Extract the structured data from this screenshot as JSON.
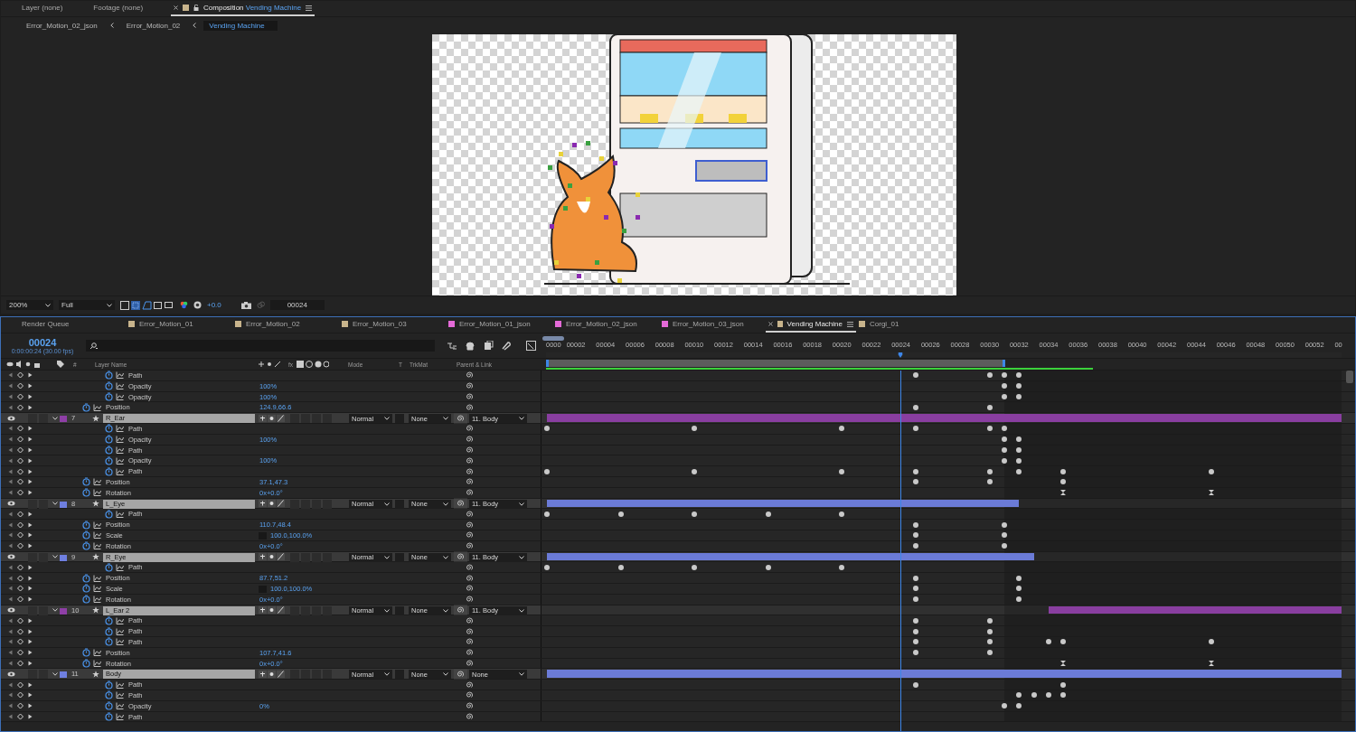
{
  "viewer_tabs": [
    {
      "label": "Layer (none)",
      "kind": "plain",
      "selected": false
    },
    {
      "label": "Footage (none)",
      "kind": "plain",
      "selected": false
    },
    {
      "label": "Composition",
      "name": "Vending Machine",
      "kind": "composition",
      "selected": true,
      "color": "#c8b48c"
    }
  ],
  "breadcrumbs": [
    {
      "label": "Error_Motion_02_json",
      "selected": false
    },
    {
      "label": "Error_Motion_02",
      "selected": false
    },
    {
      "label": "Vending Machine",
      "selected": true
    }
  ],
  "viewer_toolbar": {
    "zoom": "200%",
    "resolution": "Full",
    "exposure": "+0.0",
    "frame": "00024"
  },
  "timeline_tabs": [
    {
      "label": "Render Queue",
      "selected": false
    },
    {
      "label": "Error_Motion_01",
      "selected": false,
      "color": "#c8b48c"
    },
    {
      "label": "Error_Motion_02",
      "selected": false,
      "color": "#c8b48c"
    },
    {
      "label": "Error_Motion_03",
      "selected": false,
      "color": "#c8b48c"
    },
    {
      "label": "Error_Motion_01_json",
      "selected": false,
      "color": "#e46ad8"
    },
    {
      "label": "Error_Motion_02_json",
      "selected": false,
      "color": "#e46ad8"
    },
    {
      "label": "Error_Motion_03_json",
      "selected": false,
      "color": "#e46ad8"
    },
    {
      "label": "Vending Machine",
      "selected": true,
      "color": "#c8b48c"
    },
    {
      "label": "Corgi_01",
      "selected": false,
      "color": "#c8b48c"
    }
  ],
  "timecode": {
    "frame": "00024",
    "time": "0:00:00:24 (30.00 fps)"
  },
  "columns": {
    "number": "#",
    "layer_name": "Layer Name",
    "fx": "fx",
    "mode": "Mode",
    "t": "T",
    "trkmat": "TrkMat",
    "parent": "Parent & Link"
  },
  "ruler": [
    "0000",
    "00002",
    "00004",
    "00006",
    "00008",
    "00010",
    "00012",
    "00014",
    "00016",
    "00018",
    "00020",
    "00022",
    "00024",
    "00026",
    "00028",
    "00030",
    "00032",
    "00034",
    "00036",
    "00038",
    "00040",
    "00042",
    "00044",
    "00046",
    "00048",
    "00050",
    "00052",
    "00"
  ],
  "playhead": {
    "level": 0.446
  },
  "work_area": {
    "level": 0.577
  },
  "render_cache": {
    "level": 0.687
  },
  "partial_layer": {
    "properties": [
      {
        "name": "Path",
        "kind": "shape"
      },
      {
        "name": "Opacity",
        "kind": "shape",
        "value": "100%"
      },
      {
        "name": "Opacity",
        "kind": "shape",
        "value": "100%"
      },
      {
        "name": "Position",
        "kind": "transform",
        "value": "124.9,66.6"
      }
    ]
  },
  "layers": [
    {
      "number": "7",
      "name": "R_Ear",
      "color": "#8e3fa6",
      "expanded": true,
      "mode": "Normal",
      "trkmat": "None",
      "parent": "11. Body",
      "properties": [
        {
          "name": "Path",
          "kind": "shape"
        },
        {
          "name": "Opacity",
          "kind": "shape",
          "value": "100%"
        },
        {
          "name": "Path",
          "kind": "shape"
        },
        {
          "name": "Opacity",
          "kind": "shape",
          "value": "100%"
        },
        {
          "name": "Path",
          "kind": "shape"
        },
        {
          "name": "Position",
          "kind": "transform",
          "value": "37.1,47.3"
        },
        {
          "name": "Rotation",
          "kind": "transform",
          "value": "0x+0.0°"
        }
      ]
    },
    {
      "number": "8",
      "name": "L_Eye",
      "color": "#6f7fe0",
      "expanded": true,
      "mode": "Normal",
      "trkmat": "None",
      "parent": "11. Body",
      "properties": [
        {
          "name": "Path",
          "kind": "shape"
        },
        {
          "name": "Position",
          "kind": "transform",
          "value": "110.7,48.4"
        },
        {
          "name": "Scale",
          "kind": "scale",
          "value": "100.0,100.0%"
        },
        {
          "name": "Rotation",
          "kind": "transform",
          "value": "0x+0.0°"
        }
      ]
    },
    {
      "number": "9",
      "name": "R_Eye",
      "color": "#6f7fe0",
      "expanded": true,
      "mode": "Normal",
      "trkmat": "None",
      "parent": "11. Body",
      "properties": [
        {
          "name": "Path",
          "kind": "shape"
        },
        {
          "name": "Position",
          "kind": "transform",
          "value": "87.7,51.2"
        },
        {
          "name": "Scale",
          "kind": "scale",
          "value": "100.0,100.0%"
        },
        {
          "name": "Rotation",
          "kind": "transform",
          "value": "0x+0.0°"
        }
      ]
    },
    {
      "number": "10",
      "name": "L_Ear 2",
      "color": "#8e3fa6",
      "expanded": true,
      "mode": "Normal",
      "trkmat": "None",
      "parent": "11. Body",
      "properties": [
        {
          "name": "Path",
          "kind": "shape"
        },
        {
          "name": "Path",
          "kind": "shape"
        },
        {
          "name": "Path",
          "kind": "shape"
        },
        {
          "name": "Position",
          "kind": "transform",
          "value": "107.7,41.6"
        },
        {
          "name": "Rotation",
          "kind": "transform",
          "value": "0x+0.0°"
        }
      ]
    },
    {
      "number": "11",
      "name": "Body",
      "color": "#6f7fe0",
      "expanded": true,
      "mode": "Normal",
      "trkmat": "None",
      "parent": "None",
      "properties": [
        {
          "name": "Path",
          "kind": "shape"
        },
        {
          "name": "Path",
          "kind": "shape"
        },
        {
          "name": "Opacity",
          "kind": "shape",
          "value": "0%"
        },
        {
          "name": "Path",
          "kind": "shape"
        }
      ]
    }
  ]
}
